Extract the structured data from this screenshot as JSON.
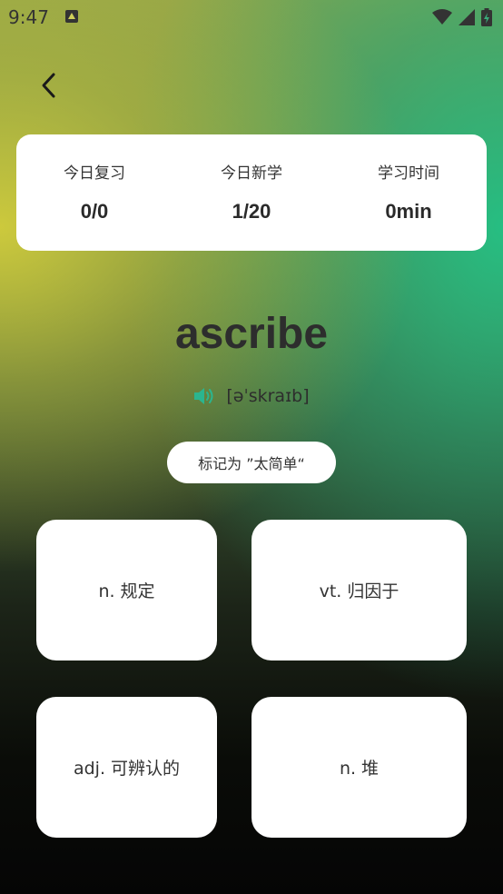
{
  "status_bar": {
    "time": "9:47"
  },
  "stats": [
    {
      "label": "今日复习",
      "value": "0/0"
    },
    {
      "label": "今日新学",
      "value": "1/20"
    },
    {
      "label": "学习时间",
      "value": "0min"
    }
  ],
  "word": {
    "text": "ascribe",
    "phonetic": "[əˈskraɪb]"
  },
  "mark_easy_label": "标记为 ”太简单“",
  "options": [
    {
      "label": "n. 规定"
    },
    {
      "label": "vt. 归因于"
    },
    {
      "label": "adj. 可辨认的"
    },
    {
      "label": "n. 堆"
    }
  ],
  "colors": {
    "speaker_accent": "#2bb58f",
    "card_bg": "#ffffff",
    "text_dark": "#2d2d2d"
  },
  "icons": [
    "a-notification-icon",
    "wifi-icon",
    "signal-icon",
    "battery-icon",
    "back-arrow-icon",
    "speaker-icon"
  ]
}
